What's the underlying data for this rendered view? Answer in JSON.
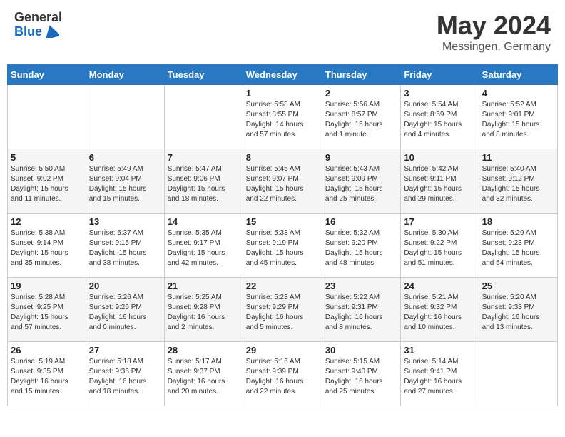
{
  "header": {
    "logo_general": "General",
    "logo_blue": "Blue",
    "title": "May 2024",
    "location": "Messingen, Germany"
  },
  "calendar": {
    "days_of_week": [
      "Sunday",
      "Monday",
      "Tuesday",
      "Wednesday",
      "Thursday",
      "Friday",
      "Saturday"
    ],
    "weeks": [
      [
        {
          "day": "",
          "info": ""
        },
        {
          "day": "",
          "info": ""
        },
        {
          "day": "",
          "info": ""
        },
        {
          "day": "1",
          "info": "Sunrise: 5:58 AM\nSunset: 8:55 PM\nDaylight: 14 hours\nand 57 minutes."
        },
        {
          "day": "2",
          "info": "Sunrise: 5:56 AM\nSunset: 8:57 PM\nDaylight: 15 hours\nand 1 minute."
        },
        {
          "day": "3",
          "info": "Sunrise: 5:54 AM\nSunset: 8:59 PM\nDaylight: 15 hours\nand 4 minutes."
        },
        {
          "day": "4",
          "info": "Sunrise: 5:52 AM\nSunset: 9:01 PM\nDaylight: 15 hours\nand 8 minutes."
        }
      ],
      [
        {
          "day": "5",
          "info": "Sunrise: 5:50 AM\nSunset: 9:02 PM\nDaylight: 15 hours\nand 11 minutes."
        },
        {
          "day": "6",
          "info": "Sunrise: 5:49 AM\nSunset: 9:04 PM\nDaylight: 15 hours\nand 15 minutes."
        },
        {
          "day": "7",
          "info": "Sunrise: 5:47 AM\nSunset: 9:06 PM\nDaylight: 15 hours\nand 18 minutes."
        },
        {
          "day": "8",
          "info": "Sunrise: 5:45 AM\nSunset: 9:07 PM\nDaylight: 15 hours\nand 22 minutes."
        },
        {
          "day": "9",
          "info": "Sunrise: 5:43 AM\nSunset: 9:09 PM\nDaylight: 15 hours\nand 25 minutes."
        },
        {
          "day": "10",
          "info": "Sunrise: 5:42 AM\nSunset: 9:11 PM\nDaylight: 15 hours\nand 29 minutes."
        },
        {
          "day": "11",
          "info": "Sunrise: 5:40 AM\nSunset: 9:12 PM\nDaylight: 15 hours\nand 32 minutes."
        }
      ],
      [
        {
          "day": "12",
          "info": "Sunrise: 5:38 AM\nSunset: 9:14 PM\nDaylight: 15 hours\nand 35 minutes."
        },
        {
          "day": "13",
          "info": "Sunrise: 5:37 AM\nSunset: 9:15 PM\nDaylight: 15 hours\nand 38 minutes."
        },
        {
          "day": "14",
          "info": "Sunrise: 5:35 AM\nSunset: 9:17 PM\nDaylight: 15 hours\nand 42 minutes."
        },
        {
          "day": "15",
          "info": "Sunrise: 5:33 AM\nSunset: 9:19 PM\nDaylight: 15 hours\nand 45 minutes."
        },
        {
          "day": "16",
          "info": "Sunrise: 5:32 AM\nSunset: 9:20 PM\nDaylight: 15 hours\nand 48 minutes."
        },
        {
          "day": "17",
          "info": "Sunrise: 5:30 AM\nSunset: 9:22 PM\nDaylight: 15 hours\nand 51 minutes."
        },
        {
          "day": "18",
          "info": "Sunrise: 5:29 AM\nSunset: 9:23 PM\nDaylight: 15 hours\nand 54 minutes."
        }
      ],
      [
        {
          "day": "19",
          "info": "Sunrise: 5:28 AM\nSunset: 9:25 PM\nDaylight: 15 hours\nand 57 minutes."
        },
        {
          "day": "20",
          "info": "Sunrise: 5:26 AM\nSunset: 9:26 PM\nDaylight: 16 hours\nand 0 minutes."
        },
        {
          "day": "21",
          "info": "Sunrise: 5:25 AM\nSunset: 9:28 PM\nDaylight: 16 hours\nand 2 minutes."
        },
        {
          "day": "22",
          "info": "Sunrise: 5:23 AM\nSunset: 9:29 PM\nDaylight: 16 hours\nand 5 minutes."
        },
        {
          "day": "23",
          "info": "Sunrise: 5:22 AM\nSunset: 9:31 PM\nDaylight: 16 hours\nand 8 minutes."
        },
        {
          "day": "24",
          "info": "Sunrise: 5:21 AM\nSunset: 9:32 PM\nDaylight: 16 hours\nand 10 minutes."
        },
        {
          "day": "25",
          "info": "Sunrise: 5:20 AM\nSunset: 9:33 PM\nDaylight: 16 hours\nand 13 minutes."
        }
      ],
      [
        {
          "day": "26",
          "info": "Sunrise: 5:19 AM\nSunset: 9:35 PM\nDaylight: 16 hours\nand 15 minutes."
        },
        {
          "day": "27",
          "info": "Sunrise: 5:18 AM\nSunset: 9:36 PM\nDaylight: 16 hours\nand 18 minutes."
        },
        {
          "day": "28",
          "info": "Sunrise: 5:17 AM\nSunset: 9:37 PM\nDaylight: 16 hours\nand 20 minutes."
        },
        {
          "day": "29",
          "info": "Sunrise: 5:16 AM\nSunset: 9:39 PM\nDaylight: 16 hours\nand 22 minutes."
        },
        {
          "day": "30",
          "info": "Sunrise: 5:15 AM\nSunset: 9:40 PM\nDaylight: 16 hours\nand 25 minutes."
        },
        {
          "day": "31",
          "info": "Sunrise: 5:14 AM\nSunset: 9:41 PM\nDaylight: 16 hours\nand 27 minutes."
        },
        {
          "day": "",
          "info": ""
        }
      ]
    ]
  }
}
